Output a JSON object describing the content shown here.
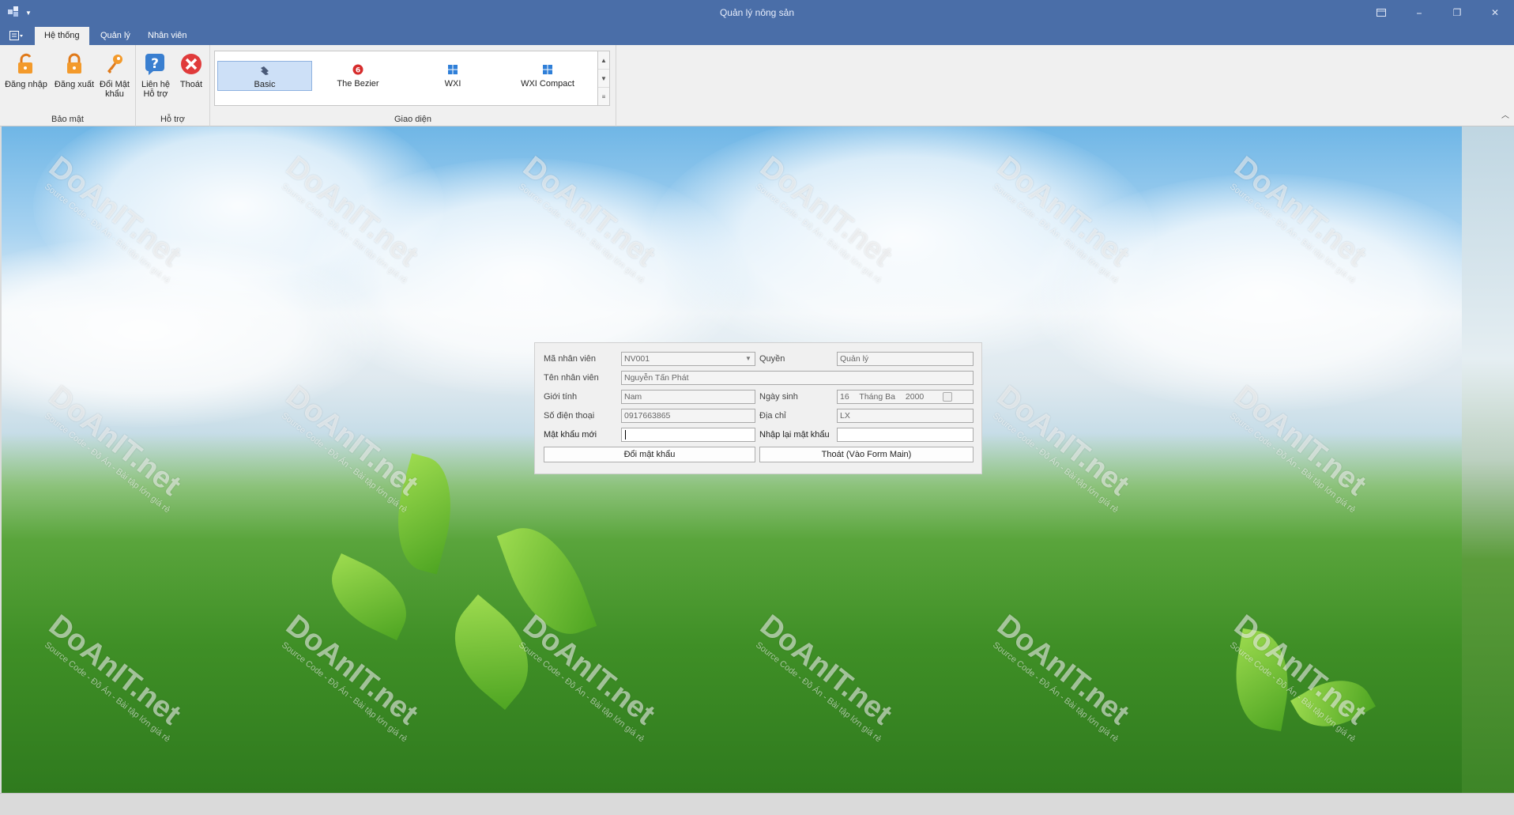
{
  "window": {
    "title": "Quản lý nông sản",
    "min_label": "⎯",
    "restore_label": "❐",
    "close_label": "✕"
  },
  "tabs": [
    {
      "label": "Hệ thống",
      "active": true
    },
    {
      "label": "Quản lý",
      "active": false
    },
    {
      "label": "Nhân viên",
      "active": false
    }
  ],
  "ribbon": {
    "bao_mat": {
      "label": "Bảo mật",
      "login": "Đăng nhập",
      "logout": "Đăng xuất",
      "change_pw_1": "Đổi Mật",
      "change_pw_2": "khẩu"
    },
    "ho_tro": {
      "label": "Hỗ trợ",
      "contact_1": "Liên hệ",
      "contact_2": "Hỗ trợ",
      "exit": "Thoát"
    },
    "giao_dien": {
      "label": "Giao diện",
      "items": [
        "Basic",
        "The Bezier",
        "WXI",
        "WXI Compact"
      ],
      "selected": "Basic"
    }
  },
  "watermark": {
    "brand": "DoAnIT.net",
    "sub": "Source Code - Đồ Án - Bài tập lớn giá rẻ"
  },
  "form": {
    "ma_nv_label": "Mã nhân viên",
    "ma_nv_value": "NV001",
    "quyen_label": "Quyền",
    "quyen_value": "Quản lý",
    "ten_label": "Tên nhân viên",
    "ten_value": "Nguyễn Tấn Phát",
    "gioitinh_label": "Giới tính",
    "gioitinh_value": "Nam",
    "ngaysinh_label": "Ngày sinh",
    "ngaysinh_day": "16",
    "ngaysinh_month": "Tháng Ba",
    "ngaysinh_year": "2000",
    "sdt_label": "Số điện thoại",
    "sdt_value": "0917663865",
    "diachi_label": "Địa chỉ",
    "diachi_value": "LX",
    "mk_moi_label": "Mật khẩu mới",
    "mk_moi_value": "",
    "nhaplai_label": "Nhập lại mật khẩu",
    "nhaplai_value": "",
    "btn_doi": "Đổi mật khẩu",
    "btn_thoat": "Thoát (Vào Form Main)"
  },
  "colors": {
    "titlebar": "#4a6ea8",
    "ribbon": "#f0f0f0",
    "selected_skin": "#cde0f7"
  }
}
